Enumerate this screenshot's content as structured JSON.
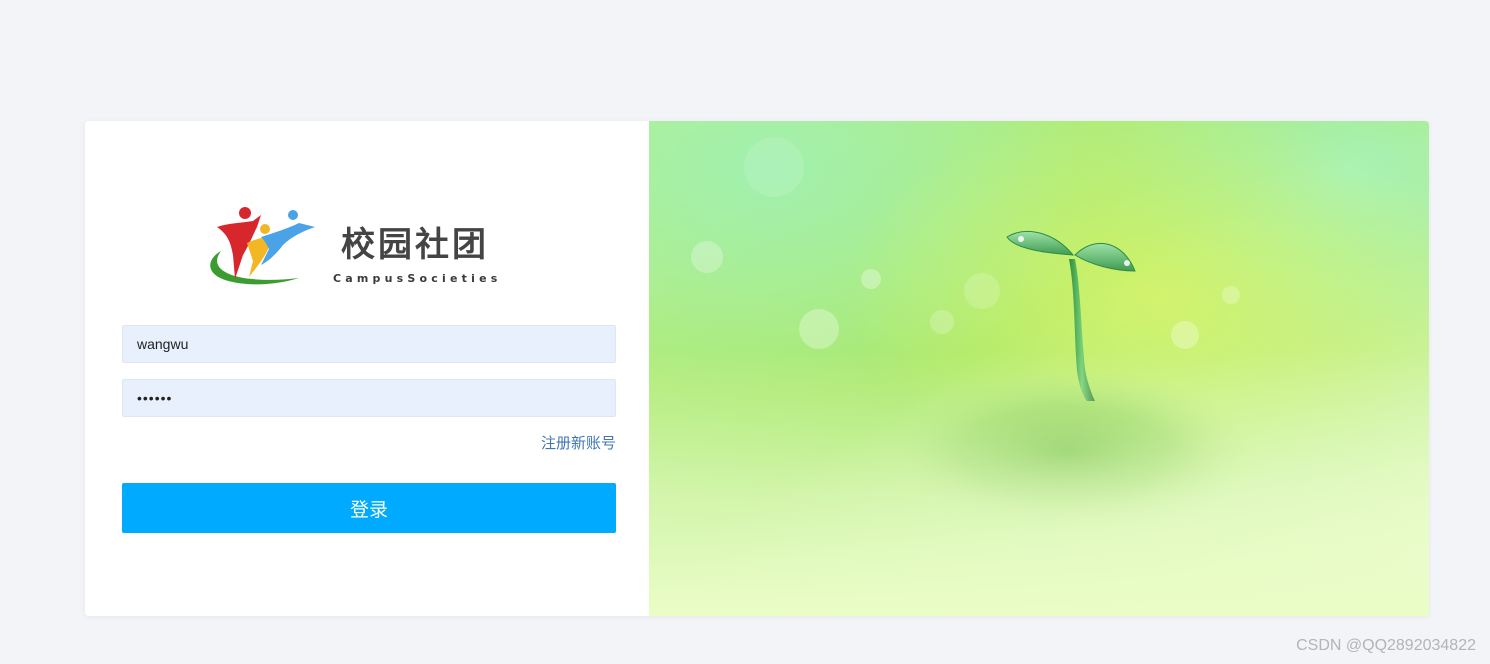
{
  "logo": {
    "title": "校园社团",
    "subtitle": "CampusSocieties"
  },
  "form": {
    "username_value": "wangwu",
    "password_value": "••••••",
    "register_link": "注册新账号",
    "login_button": "登录"
  },
  "hero": {
    "image": "seedling-sprout"
  },
  "watermark": "CSDN @QQ2892034822",
  "colors": {
    "page_background": "#f3f4f8",
    "input_background": "#e8f0fe",
    "link": "#3f76b5",
    "button": "#00aaff",
    "hero_green": "#a9e870"
  }
}
